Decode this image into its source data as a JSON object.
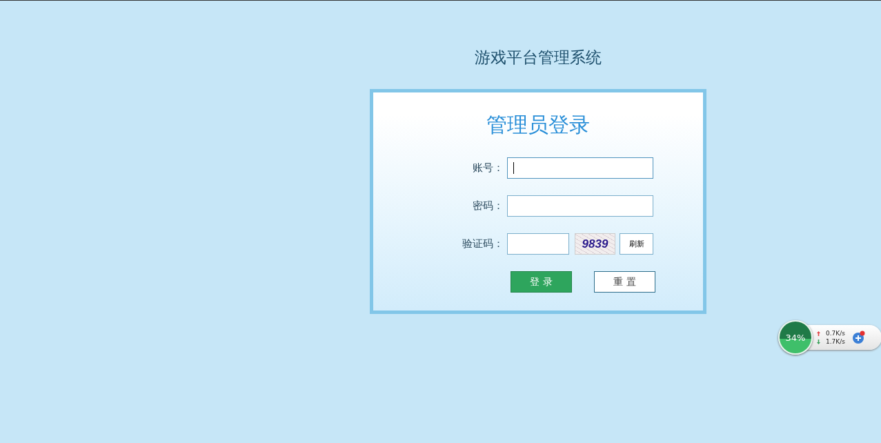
{
  "page_title": "游戏平台管理系统",
  "login_card": {
    "title": "管理员登录",
    "fields": [
      {
        "kind": "text",
        "label": "账号：",
        "focused": true
      },
      {
        "kind": "password",
        "label": "密码：",
        "focused": false
      },
      {
        "kind": "captcha",
        "label": "验证码：",
        "focused": false,
        "captcha": "9839",
        "refresh": "刷新"
      }
    ],
    "buttons": [
      {
        "kind": "primary",
        "label": "登 录"
      },
      {
        "kind": "secondary",
        "label": "重 置"
      }
    ]
  },
  "speed_widget": {
    "percent": "34%",
    "upload": "0.7K/s",
    "download": "1.7K/s"
  }
}
